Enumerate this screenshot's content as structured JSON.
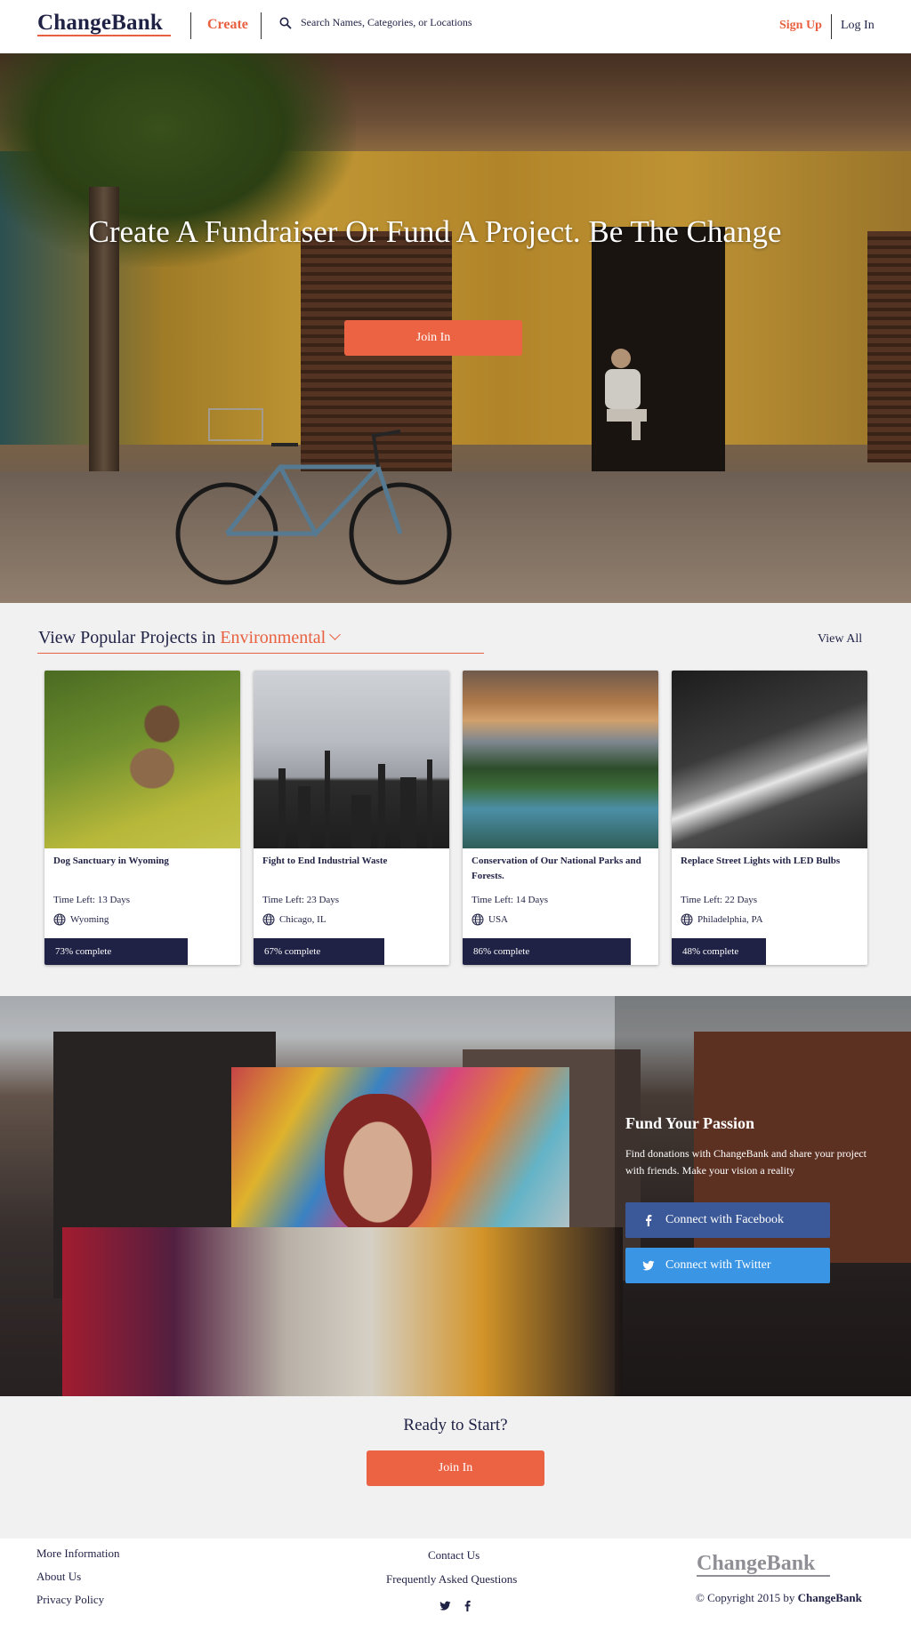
{
  "header": {
    "logo": "ChangeBank",
    "create": "Create",
    "search_placeholder": "Search Names, Categories, or Locations",
    "sign_up": "Sign Up",
    "log_in": "Log In"
  },
  "hero": {
    "title": "Create A Fundraiser Or Fund A Project. Be The Change",
    "button": "Join In"
  },
  "projects": {
    "heading_prefix": "View Popular Projects in",
    "category": "Environmental",
    "view_all": "View All",
    "cards": [
      {
        "title": "Dog Sanctuary in Wyoming",
        "time_left": "Time Left: 13 Days",
        "location": "Wyoming",
        "progress_label": "73% complete",
        "progress": 0.73
      },
      {
        "title": "Fight to End Industrial Waste",
        "time_left": "Time Left: 23 Days",
        "location": "Chicago, IL",
        "progress_label": "67% complete",
        "progress": 0.67
      },
      {
        "title": "Conservation of Our National Parks and Forests.",
        "time_left": "Time Left: 14 Days",
        "location": "USA",
        "progress_label": "86% complete",
        "progress": 0.86
      },
      {
        "title": "Replace Street Lights with LED Bulbs",
        "time_left": "Time Left: 22 Days",
        "location": "Philadelphia, PA",
        "progress_label": "48% complete",
        "progress": 0.48
      }
    ]
  },
  "passion": {
    "title": "Fund Your Passion",
    "text": "Find donations with ChangeBank and share your project with friends. Make your vision a reality",
    "facebook": "Connect with Facebook",
    "twitter": "Connect with Twitter"
  },
  "ready": {
    "title": "Ready to Start?",
    "button": "Join In"
  },
  "footer": {
    "more_info": "More Information",
    "about": "About Us",
    "privacy": "Privacy Policy",
    "contact": "Contact Us",
    "faq": "Frequently Asked Questions",
    "logo": "ChangeBank",
    "copyright_prefix": "© Copyright 2015 by",
    "copyright_brand": "ChangeBank"
  },
  "colors": {
    "accent": "#e8603f",
    "navy": "#1f2145",
    "facebook": "#3b5998",
    "twitter": "#3a95e4"
  }
}
